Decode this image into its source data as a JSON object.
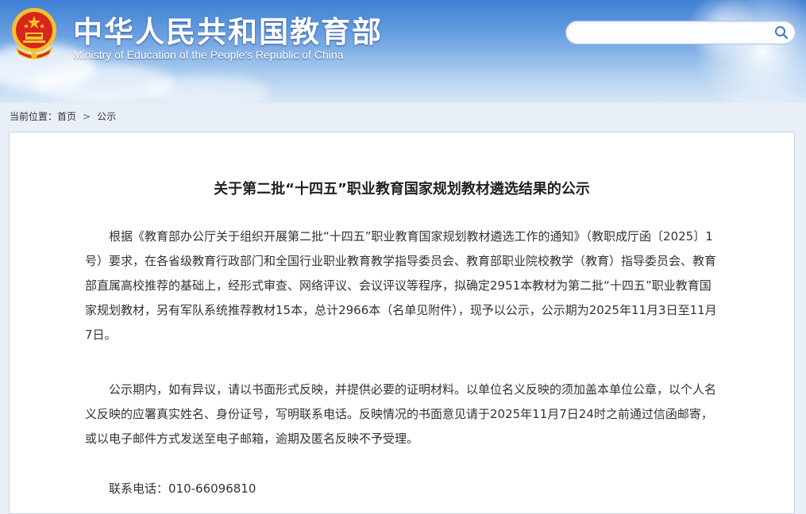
{
  "header": {
    "title": "中华人民共和国教育部",
    "subtitle": "Ministry of Education of the People's Republic of China",
    "search": {
      "placeholder": "",
      "value": ""
    }
  },
  "breadcrumb": {
    "label": "当前位置：",
    "items": [
      "首页",
      "公示"
    ],
    "separator": ">"
  },
  "article": {
    "title": "关于第二批“十四五”职业教育国家规划教材遴选结果的公示",
    "paragraphs": [
      "根据《教育部办公厅关于组织开展第二批“十四五”职业教育国家规划教材遴选工作的通知》（教职成厅函〔2025〕1号）要求，在各省级教育行政部门和全国行业职业教育教学指导委员会、教育部职业院校教学（教育）指导委员会、教育部直属高校推荐的基础上，经形式审查、网络评议、会议评议等程序，拟确定2951本教材为第二批“十四五”职业教育国家规划教材，另有军队系统推荐教材15本，总计2966本（名单见附件），现予以公示，公示期为2025年11月3日至11月7日。",
      "公示期内，如有异议，请以书面形式反映，并提供必要的证明材料。以单位名义反映的须加盖本单位公章，以个人名义反映的应署真实姓名、身份证号，写明联系电话。反映情况的书面意见请于2025年11月7日24时之前通过信函邮寄，或以电子邮件方式发送至电子邮箱，逾期及匿名反映不予受理。",
      "联系电话：010-66096810"
    ]
  },
  "colors": {
    "header_blue": "#3f7fd3",
    "emblem_red": "#d7261b",
    "emblem_gold": "#f2c230"
  }
}
